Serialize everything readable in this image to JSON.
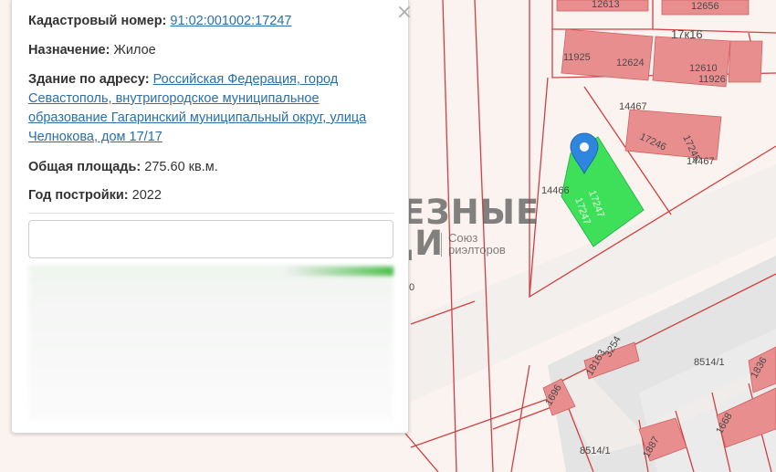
{
  "popup": {
    "cadastral_label": "Кадастровый номер:",
    "cadastral_value": "91:02:001002:17247",
    "purpose_label": "Назначение:",
    "purpose_value": "Жилое",
    "building_label": "Здание по адресу:",
    "address_line1": "Российская Федерация, город",
    "address_line2": "Севастополь, внутригородское муниципальное",
    "address_line3": "образование Гагаринский муниципальный округ, улица",
    "address_line4": "Челнокова, дом 17/17",
    "area_label": "Общая площадь:",
    "area_value": "275.60 кв.м.",
    "year_label": "Год постройки:",
    "year_value": "2022",
    "close_symbol": "×"
  },
  "watermark": {
    "line1": "ПОЛЕЗНЫЕ",
    "line2": "ЛЮДИ",
    "sub1": "Союз",
    "sub2": "риэлторов"
  },
  "map_labels": {
    "l12613": "12613",
    "l12656": "12656",
    "l17k16": "17к16",
    "l11925": "11925",
    "l12624": "12624",
    "l12610": "12610",
    "l11926": "11926",
    "l14467a": "14467",
    "l17246": "17246",
    "l17245": "17245",
    "l14467b": "14467",
    "l14466": "14466",
    "l17247a": "17247",
    "l17247b": "17247",
    "l0": "0",
    "l3254": "3254",
    "l18163": "18163",
    "l8514a": "8514/1",
    "l1836": "1836",
    "l1696": "1696",
    "l1887": "1887",
    "l8514b": "8514/1",
    "l1668": "1668"
  },
  "colors": {
    "parcel_line": "#d04040",
    "building_fill": "#e88e8e",
    "selected_fill": "#3ee05a",
    "road": "#e6e6e6",
    "marker": "#2e86de"
  }
}
